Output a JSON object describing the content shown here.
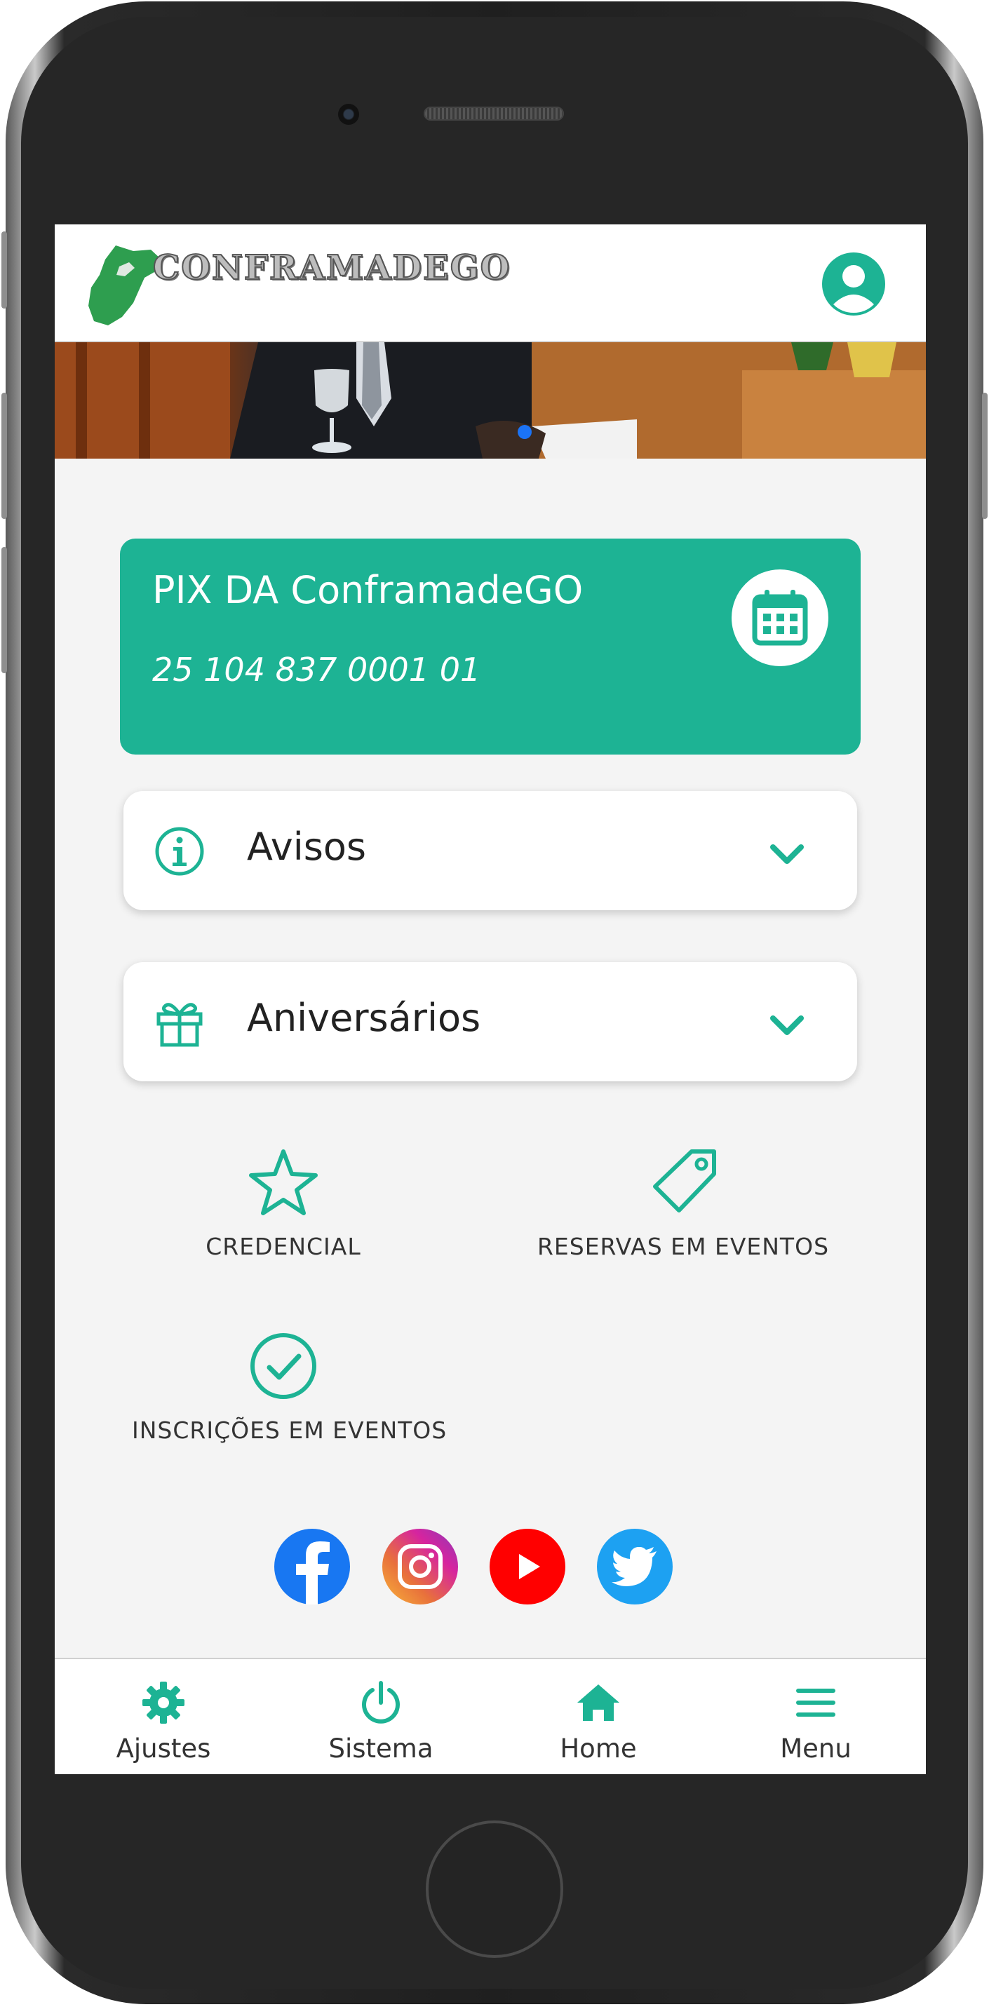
{
  "header": {
    "logo_text": "CONFRAMADEGO",
    "profile_icon": "user-circle-icon"
  },
  "banner": {
    "active_slide_indicator": "carousel-dot"
  },
  "pix_card": {
    "title": "PIX DA ConframadeGO",
    "key": "25 104 837 0001 01",
    "icon": "calendar-icon",
    "color": "#1db394"
  },
  "accordions": [
    {
      "label": "Avisos",
      "icon": "info-icon"
    },
    {
      "label": "Aniversários",
      "icon": "gift-icon"
    }
  ],
  "quick_links": [
    {
      "label": "CREDENCIAL",
      "icon": "star-icon"
    },
    {
      "label": "RESERVAS EM EVENTOS",
      "icon": "tag-icon"
    },
    {
      "label": "INSCRIÇÕES EM EVENTOS",
      "icon": "check-circle-icon"
    }
  ],
  "social": [
    {
      "name": "facebook-icon",
      "color": "#1877f2"
    },
    {
      "name": "instagram-icon",
      "color": "#d6249f"
    },
    {
      "name": "youtube-icon",
      "color": "#ff0000"
    },
    {
      "name": "twitter-icon",
      "color": "#1da1f2"
    }
  ],
  "bottom_nav": [
    {
      "label": "Ajustes",
      "icon": "gear-icon"
    },
    {
      "label": "Sistema",
      "icon": "power-icon"
    },
    {
      "label": "Home",
      "icon": "home-icon"
    },
    {
      "label": "Menu",
      "icon": "hamburger-menu-icon"
    }
  ],
  "accent_color": "#1db394"
}
